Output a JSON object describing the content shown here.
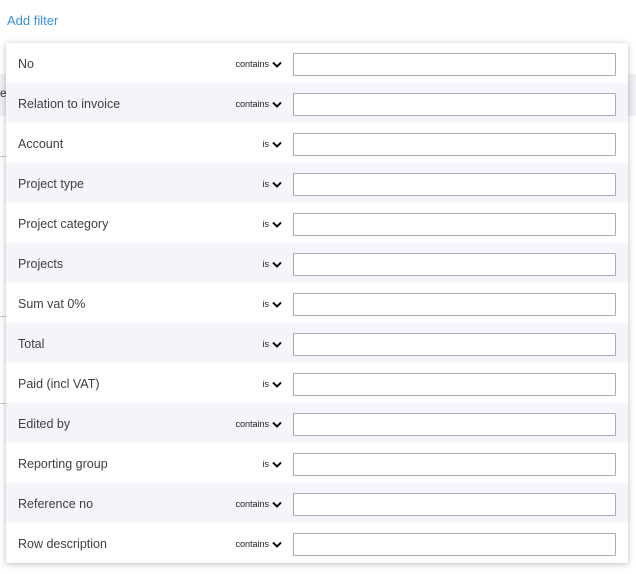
{
  "add_filter_label": "Add filter",
  "background_text": "e",
  "colors": {
    "link": "#3a8fd6",
    "row_alt": "#f4f5f8",
    "border": "#a7abb3"
  },
  "filters": [
    {
      "label": "No",
      "operator": "contains",
      "value": ""
    },
    {
      "label": "Relation to invoice",
      "operator": "contains",
      "value": ""
    },
    {
      "label": "Account",
      "operator": "is",
      "value": ""
    },
    {
      "label": "Project type",
      "operator": "is",
      "value": ""
    },
    {
      "label": "Project category",
      "operator": "is",
      "value": ""
    },
    {
      "label": "Projects",
      "operator": "is",
      "value": ""
    },
    {
      "label": "Sum vat 0%",
      "operator": "is",
      "value": ""
    },
    {
      "label": "Total",
      "operator": "is",
      "value": ""
    },
    {
      "label": "Paid (incl VAT)",
      "operator": "is",
      "value": ""
    },
    {
      "label": "Edited by",
      "operator": "contains",
      "value": ""
    },
    {
      "label": "Reporting group",
      "operator": "is",
      "value": ""
    },
    {
      "label": "Reference no",
      "operator": "contains",
      "value": ""
    },
    {
      "label": "Row description",
      "operator": "contains",
      "value": ""
    }
  ]
}
